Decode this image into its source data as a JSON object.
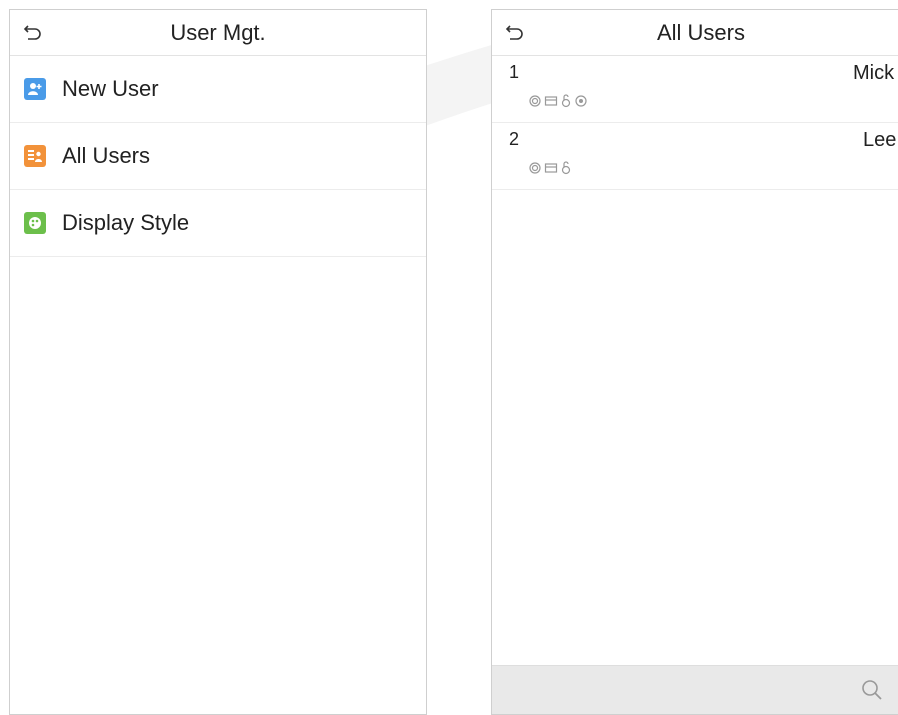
{
  "left": {
    "title": "User Mgt.",
    "menu": [
      {
        "label": "New User",
        "icon": "new-user-icon",
        "color": "#4a9be8"
      },
      {
        "label": "All Users",
        "icon": "all-users-icon",
        "color": "#f2923a"
      },
      {
        "label": "Display Style",
        "icon": "display-style-icon",
        "color": "#6cbf4b"
      }
    ]
  },
  "right": {
    "title": "All Users",
    "users": [
      {
        "id": "1",
        "name": "Mick",
        "verify_icons": [
          "fingerprint-icon",
          "card-icon",
          "password-icon",
          "face-icon"
        ]
      },
      {
        "id": "2",
        "name": "Lee",
        "verify_icons": [
          "fingerprint-icon",
          "card-icon",
          "password-icon"
        ]
      }
    ],
    "search": {
      "placeholder": "",
      "value": ""
    }
  }
}
